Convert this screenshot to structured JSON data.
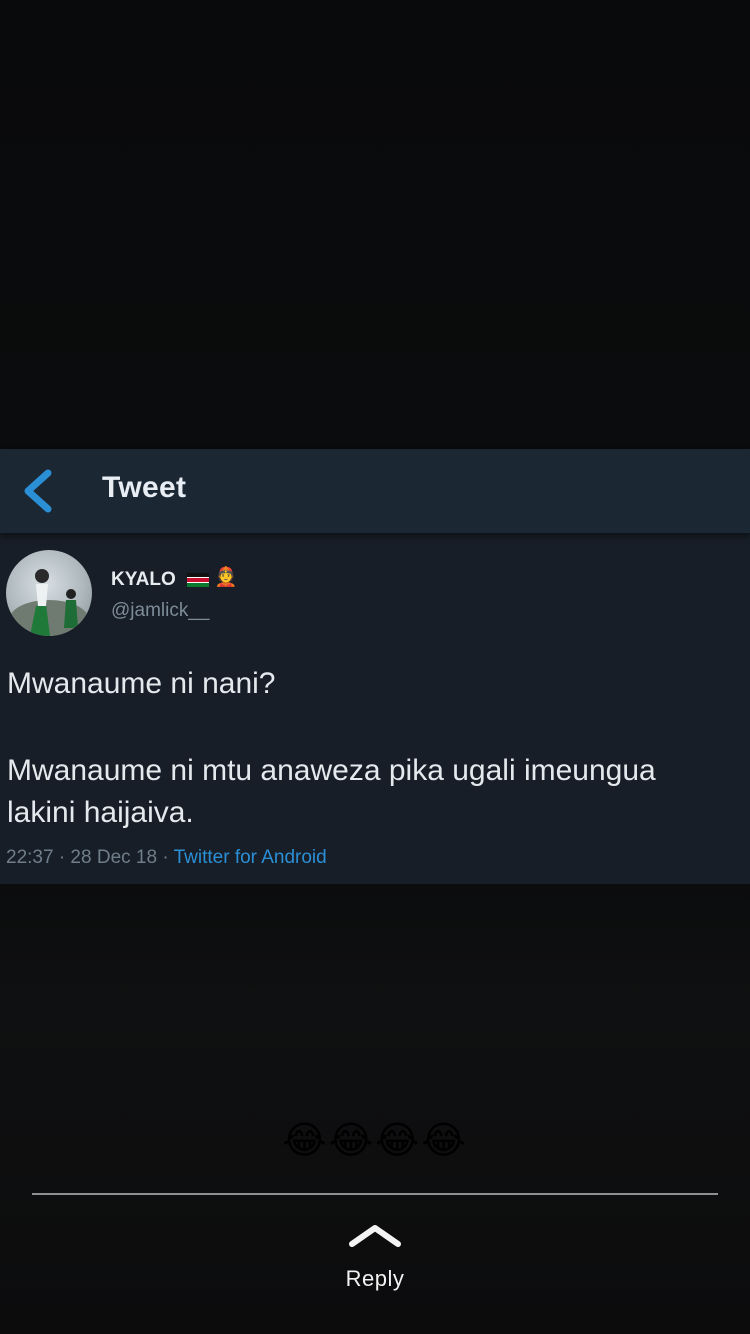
{
  "tweet_screenshot": {
    "header_title": "Tweet",
    "author": {
      "display_name": "KYALO",
      "badge_emoji": "👲",
      "handle": "@jamlick__"
    },
    "text_lines": [
      "Mwanaume ni nani?",
      "Mwanaume ni mtu anaweza pika ugali imeungua",
      "lakini haijaiva."
    ],
    "meta": {
      "time_date": "22:37 · 28 Dec 18 · ",
      "source": "Twitter for Android"
    },
    "colors": {
      "accent": "#2b8fd6",
      "header_bg": "#1b2733",
      "body_bg": "#171e27"
    }
  },
  "caption": "😂😂😂😂",
  "reply": {
    "label": "Reply",
    "icon": "chevron-up-icon"
  }
}
